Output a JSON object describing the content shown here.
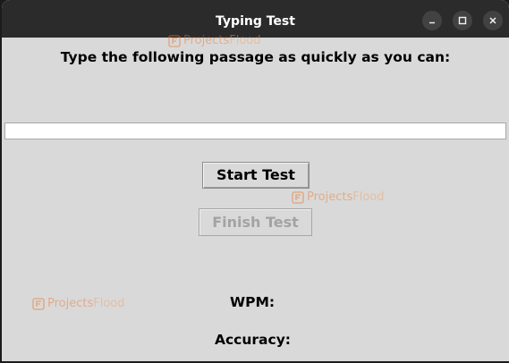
{
  "window": {
    "title": "Typing Test",
    "controls": {
      "minimize_icon": "minimize-icon",
      "maximize_icon": "maximize-icon",
      "close_icon": "close-icon"
    }
  },
  "watermark": {
    "part1": "Projects",
    "part2": "Flood",
    "icon": "projectsflood-logo",
    "colors": {
      "primary": "#e8772e",
      "secondary": "#f0a060"
    }
  },
  "main": {
    "prompt": "Type the following passage as quickly as you can:",
    "passage": "",
    "input_value": "",
    "start_button_label": "Start Test",
    "finish_button_label": "Finish Test",
    "finish_button_disabled": true,
    "wpm_label": "WPM:",
    "wpm_value": "",
    "accuracy_label": "Accuracy:",
    "accuracy_value": ""
  },
  "colors": {
    "titlebar": "#2b2b2b",
    "window_background": "#d9d9d9",
    "disabled_text": "#a3a3a3"
  }
}
